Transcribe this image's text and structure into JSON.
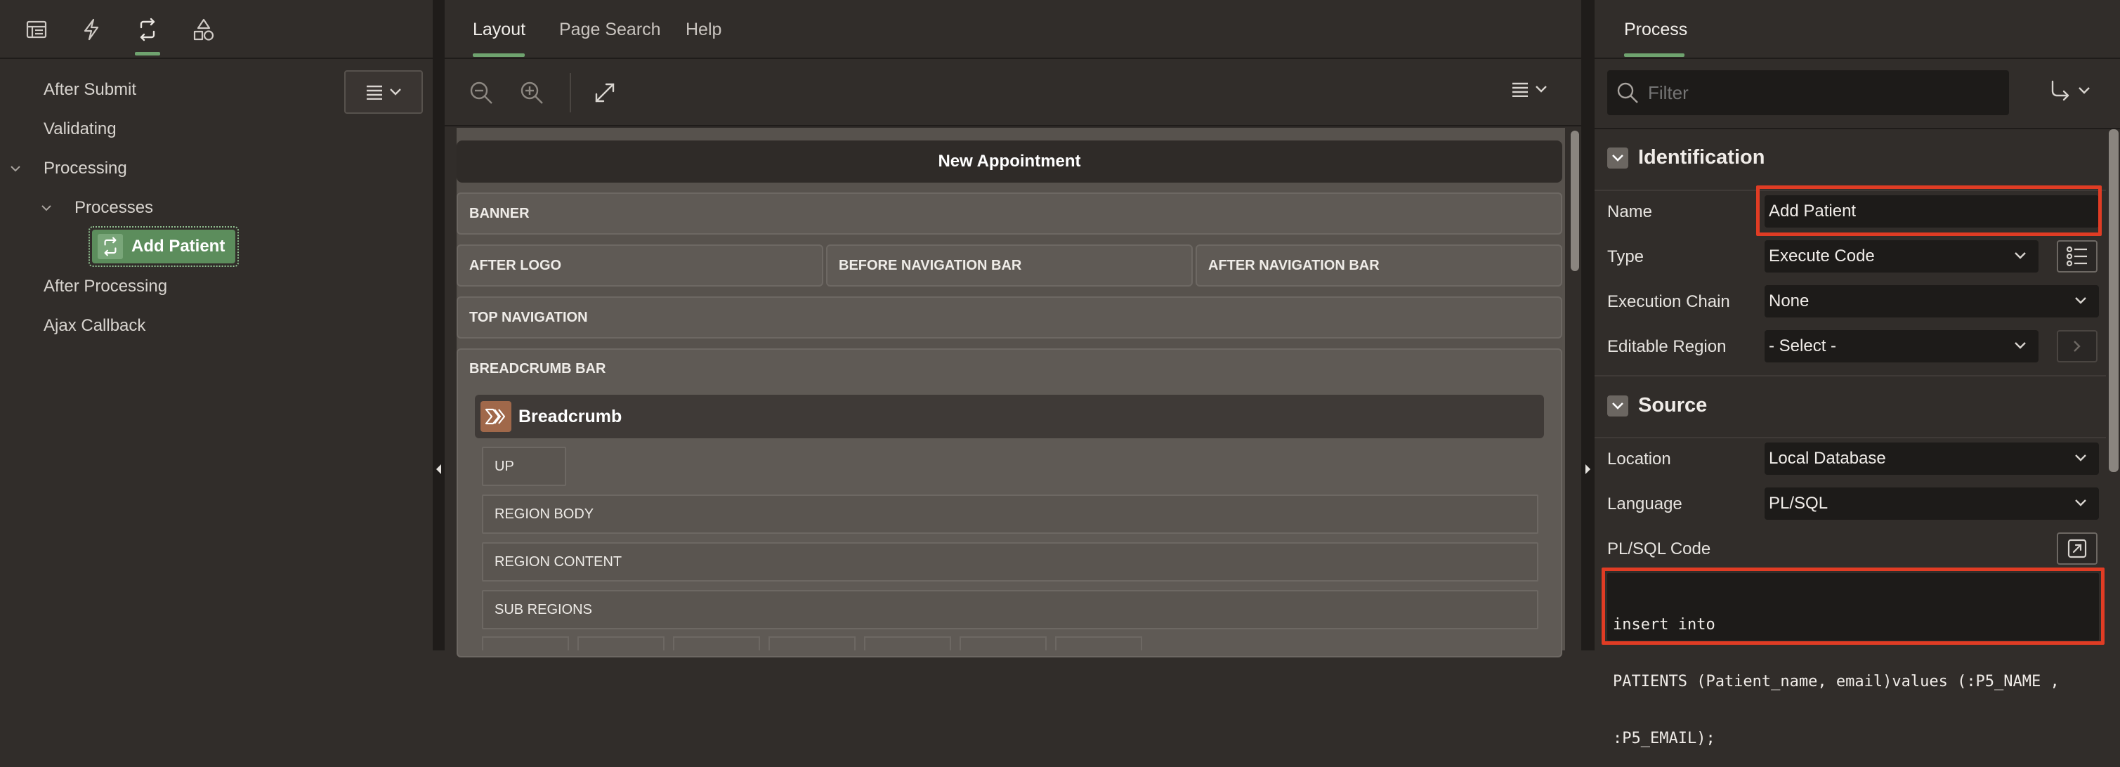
{
  "left_panel": {
    "tab_icons": [
      "rendering-icon",
      "dynamic-actions-icon",
      "processing-icon",
      "shared-components-icon"
    ],
    "menu_button_icon": "menu-icon",
    "tree": {
      "after_submit": "After Submit",
      "validating": "Validating",
      "processing": "Processing",
      "processes": "Processes",
      "selected_process": "Add Patient",
      "after_processing": "After Processing",
      "ajax_callback": "Ajax Callback"
    }
  },
  "middle_panel": {
    "tabs": [
      "Layout",
      "Page Search",
      "Help"
    ],
    "active_tab": "Layout",
    "toolbar_icons": [
      "zoom-out-icon",
      "zoom-in-icon",
      "expand-icon",
      "menu-icon"
    ],
    "layout": {
      "page_title": "New Appointment",
      "banner": "BANNER",
      "after_logo": "AFTER LOGO",
      "before_navigation_bar": "BEFORE NAVIGATION BAR",
      "after_navigation_bar": "AFTER NAVIGATION BAR",
      "top_navigation": "TOP NAVIGATION",
      "breadcrumb_bar": "BREADCRUMB BAR",
      "breadcrumb_region": "Breadcrumb",
      "up": "UP",
      "region_body": "REGION BODY",
      "region_content": "REGION CONTENT",
      "sub_regions": "SUB REGIONS"
    }
  },
  "right_panel": {
    "tab": "Process",
    "filter_placeholder": "Filter",
    "identification": {
      "header": "Identification",
      "name_label": "Name",
      "name_value": "Add Patient",
      "type_label": "Type",
      "type_value": "Execute Code",
      "execution_chain_label": "Execution Chain",
      "execution_chain_value": "None",
      "editable_region_label": "Editable Region",
      "editable_region_value": "- Select -"
    },
    "source": {
      "header": "Source",
      "location_label": "Location",
      "location_value": "Local Database",
      "language_label": "Language",
      "language_value": "PL/SQL",
      "code_label": "PL/SQL Code",
      "code_line1": "insert into",
      "code_line2": "PATIENTS (Patient_name, email)values (:P5_NAME ,",
      "code_line3": ":P5_EMAIL);"
    },
    "highlight_color": "#e03c24",
    "accent_color": "#6fa36f"
  }
}
